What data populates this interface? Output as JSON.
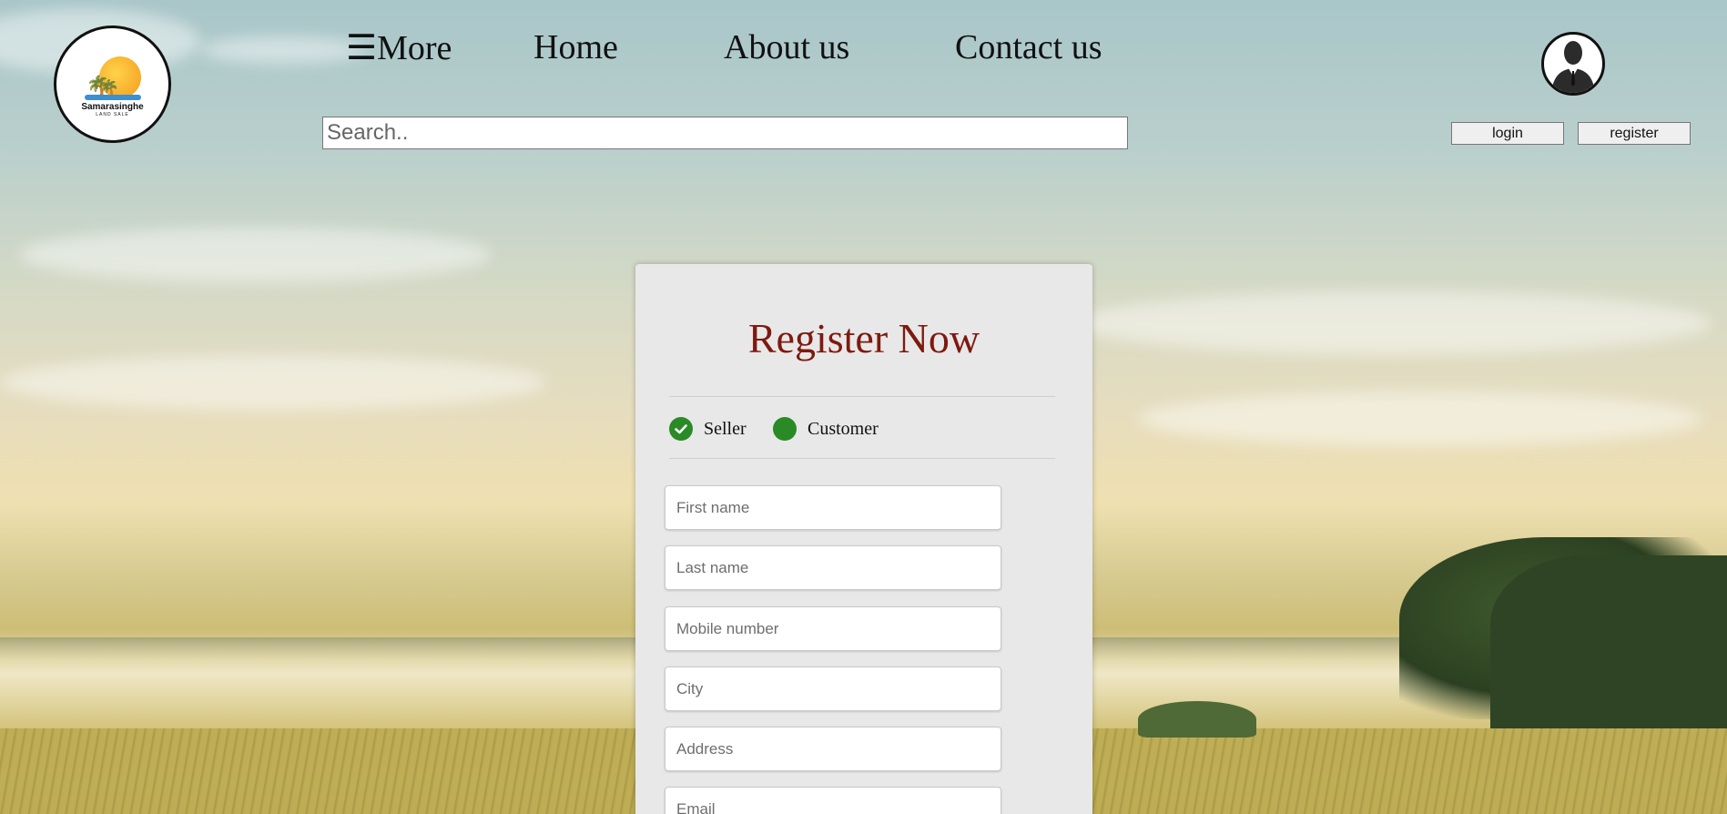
{
  "logo": {
    "name": "Samarasinghe",
    "tagline": "LAND SALE"
  },
  "nav": {
    "more_label": "☰More",
    "home_label": "Home",
    "about_label": "About us",
    "contact_label": "Contact us"
  },
  "search": {
    "placeholder": "Search.."
  },
  "account": {
    "login_label": "login",
    "register_label": "register"
  },
  "form": {
    "title": "Register Now",
    "roles": [
      {
        "label": "Seller",
        "checked": true
      },
      {
        "label": "Customer",
        "checked": false
      }
    ],
    "fields": [
      {
        "placeholder": "First name"
      },
      {
        "placeholder": "Last name"
      },
      {
        "placeholder": "Mobile number"
      },
      {
        "placeholder": "City"
      },
      {
        "placeholder": "Address"
      },
      {
        "placeholder": "Email"
      }
    ]
  },
  "colors": {
    "title": "#7d1a10",
    "role_accent": "#2a8a25",
    "card_background": "#e8e8e8"
  }
}
